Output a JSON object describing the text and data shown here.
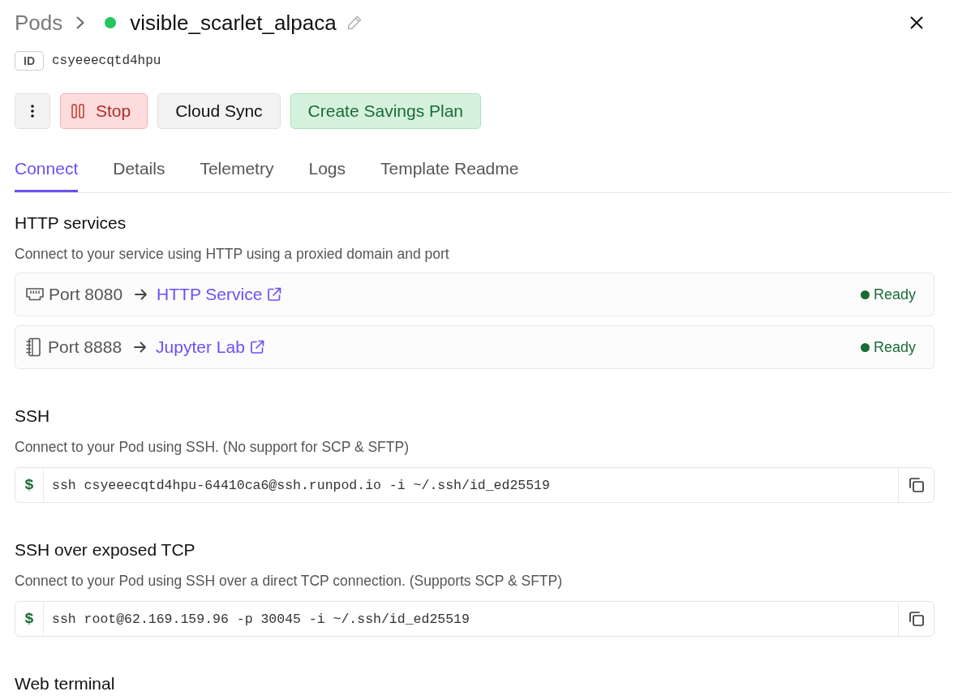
{
  "breadcrumb": {
    "parent": "Pods"
  },
  "pod": {
    "name": "visible_scarlet_alpaca",
    "running": true
  },
  "id": {
    "label": "ID",
    "value": "csyeeecqtd4hpu"
  },
  "actions": [
    {
      "kind": "menu"
    },
    {
      "kind": "stop",
      "label": "Stop"
    },
    {
      "kind": "default",
      "label": "Cloud Sync"
    },
    {
      "kind": "success",
      "label": "Create Savings Plan"
    }
  ],
  "tabs": [
    {
      "label": "Connect",
      "selected": true
    },
    {
      "label": "Details",
      "selected": false
    },
    {
      "label": "Telemetry",
      "selected": false
    },
    {
      "label": "Logs",
      "selected": false
    },
    {
      "label": "Template Readme",
      "selected": false
    }
  ],
  "sections": [
    {
      "kind": "services",
      "title": "HTTP services",
      "description": "Connect to your service using HTTP using a proxied domain and port",
      "services": [
        {
          "kind": "http",
          "port": "Port 8080",
          "link": "HTTP Service",
          "status": "Ready"
        },
        {
          "kind": "jupyter",
          "port": "Port 8888",
          "link": "Jupyter Lab",
          "status": "Ready"
        }
      ]
    },
    {
      "kind": "command",
      "title": "SSH",
      "description": "Connect to your Pod using SSH. (No support for SCP & SFTP)",
      "prompt": "$",
      "command": "ssh csyeeecqtd4hpu-64410ca6@ssh.runpod.io -i ~/.ssh/id_ed25519"
    },
    {
      "kind": "command",
      "title": "SSH over exposed TCP",
      "description": "Connect to your Pod using SSH over a direct TCP connection. (Supports SCP & SFTP)",
      "prompt": "$",
      "command": "ssh root@62.169.159.96 -p 30045 -i ~/.ssh/id_ed25519"
    },
    {
      "kind": "terminal",
      "title": "Web terminal"
    }
  ]
}
